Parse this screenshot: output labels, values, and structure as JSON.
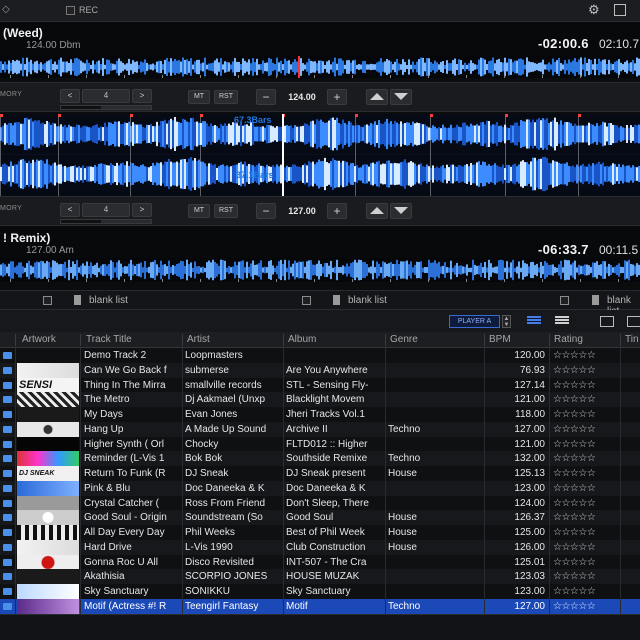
{
  "topbar": {
    "rec_label": "REC"
  },
  "deck1": {
    "title": "(Weed)",
    "key_info": "124.00 Dbm",
    "remaining": "-02:00.6",
    "elapsed": "02:10.7",
    "memory_label": "MORY",
    "beat_jump": "4",
    "mt": "MT",
    "rst": "RST",
    "bpm": "124.00",
    "bars_label": "67.3Bars"
  },
  "deck2": {
    "title": "! Remix)",
    "key_info": "127.00 Am",
    "remaining": "-06:33.7",
    "elapsed": "00:11.5",
    "memory_label": "MORY",
    "beat_jump": "4",
    "mt": "MT",
    "rst": "RST",
    "bpm": "127.00",
    "bars_label": "37.1Bars"
  },
  "controls": {
    "minus": "−",
    "plus": "+",
    "prev": "<",
    "next": ">",
    "bend_up": "▲",
    "bend_down": "▼"
  },
  "browser": {
    "tabs": [
      {
        "label": "blank list"
      },
      {
        "label": "blank list"
      },
      {
        "label": "blank list"
      }
    ],
    "player_label": "PLAYER A",
    "columns": {
      "artwork": "Artwork",
      "title": "Track Title",
      "artist": "Artist",
      "album": "Album",
      "genre": "Genre",
      "bpm": "BPM",
      "rating": "Rating",
      "time": "Tin"
    },
    "rows": [
      {
        "title": "Demo Track 2",
        "artist": "Loopmasters",
        "album": "",
        "genre": "",
        "bpm": "120.00",
        "rating": "☆☆☆☆☆",
        "art": "none"
      },
      {
        "title": "Can We Go Back f",
        "artist": "submerse",
        "album": "Are You Anywhere",
        "genre": "",
        "bpm": "76.93",
        "rating": "☆☆☆☆☆",
        "art": "white"
      },
      {
        "title": "Thing In The Mirra",
        "artist": "smallville records",
        "album": "STL - Sensing Fly-",
        "genre": "",
        "bpm": "127.14",
        "rating": "☆☆☆☆☆",
        "art": "sensi",
        "art_text": "SENSI"
      },
      {
        "title": "The Metro",
        "artist": "Dj Aakmael (Unxp",
        "album": "Blacklight Movem",
        "genre": "",
        "bpm": "121.00",
        "rating": "☆☆☆☆☆",
        "art": "mosaic"
      },
      {
        "title": "My Days",
        "artist": "Evan Jones",
        "album": "Jheri Tracks Vol.1",
        "genre": "",
        "bpm": "118.00",
        "rating": "☆☆☆☆☆",
        "art": "dark"
      },
      {
        "title": "Hang Up",
        "artist": "A Made Up Sound",
        "album": "Archive II",
        "genre": "Techno",
        "bpm": "127.00",
        "rating": "☆☆☆☆☆",
        "art": "vinyl"
      },
      {
        "title": "Higher Synth ( Orl",
        "artist": "Chocky",
        "album": "FLTD012 :: Higher",
        "genre": "",
        "bpm": "121.00",
        "rating": "☆☆☆☆☆",
        "art": "black"
      },
      {
        "title": "Reminder (L-Vis 1",
        "artist": "Bok Bok",
        "album": "Southside Remixe",
        "genre": "Techno",
        "bpm": "132.00",
        "rating": "☆☆☆☆☆",
        "art": "colorful"
      },
      {
        "title": "Return To Funk (R",
        "artist": "DJ Sneak",
        "album": "DJ Sneak present",
        "genre": "House",
        "bpm": "125.13",
        "rating": "☆☆☆☆☆",
        "art": "djsneak",
        "art_text": "DJ SNEAK"
      },
      {
        "title": "Pink & Blu",
        "artist": "Doc Daneeka & K",
        "album": "Doc Daneeka & K",
        "genre": "",
        "bpm": "123.00",
        "rating": "☆☆☆☆☆",
        "art": "blue"
      },
      {
        "title": "Crystal Catcher (",
        "artist": "Ross From Friend",
        "album": "Don't Sleep, There",
        "genre": "",
        "bpm": "124.00",
        "rating": "☆☆☆☆☆",
        "art": "grey"
      },
      {
        "title": "Good Soul - Origin",
        "artist": "Soundstream (So",
        "album": "Good Soul",
        "genre": "House",
        "bpm": "126.37",
        "rating": "☆☆☆☆☆",
        "art": "label"
      },
      {
        "title": "All Day Every Day",
        "artist": "Phil Weeks",
        "album": "Best of Phil Week",
        "genre": "House",
        "bpm": "125.00",
        "rating": "☆☆☆☆☆",
        "art": "stripes"
      },
      {
        "title": "Hard Drive",
        "artist": "L-Vis 1990",
        "album": "Club Construction",
        "genre": "House",
        "bpm": "126.00",
        "rating": "☆☆☆☆☆",
        "art": "white"
      },
      {
        "title": "Gonna Roc U All",
        "artist": "Disco Revisited",
        "album": "INT-507 - The Cra",
        "genre": "",
        "bpm": "125.01",
        "rating": "☆☆☆☆☆",
        "art": "red"
      },
      {
        "title": "Akathisia",
        "artist": "SCORPIO JONES",
        "album": "HOUSE MUZAK",
        "genre": "",
        "bpm": "123.03",
        "rating": "☆☆☆☆☆",
        "art": "dark"
      },
      {
        "title": "Sky Sanctuary",
        "artist": "SONIKKU",
        "album": "Sky Sanctuary",
        "genre": "",
        "bpm": "123.00",
        "rating": "☆☆☆☆☆",
        "art": "sky"
      },
      {
        "title": "Motif (Actress #! R",
        "artist": "Teengirl Fantasy",
        "album": "Motif",
        "genre": "Techno",
        "bpm": "127.00",
        "rating": "☆☆☆☆☆",
        "art": "purple",
        "selected": true
      }
    ]
  },
  "colors": {
    "accent": "#1c49b8",
    "wave_blue": "#2f7dff",
    "playhead": "#ff3030"
  }
}
